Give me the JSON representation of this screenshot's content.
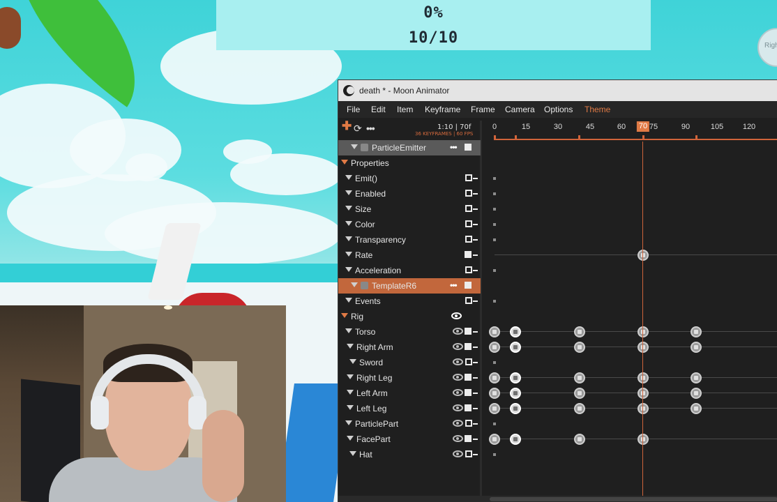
{
  "hud": {
    "percent": "0%",
    "count": "10/10"
  },
  "corner_avatar": {
    "label": "Righ"
  },
  "window": {
    "title": "death * - Moon Animator"
  },
  "menu": [
    "File",
    "Edit",
    "Item",
    "Keyframe",
    "Frame",
    "Camera",
    "Options",
    "Theme"
  ],
  "toolbar": {
    "add_icon": "plus-icon",
    "loop_icon": "loop-icon",
    "more_icon": "more-icon",
    "time": "1:10 | 70f",
    "stats": "36 KEYFRAMES | 60 FPS"
  },
  "ruler": {
    "ticks": [
      "0",
      "15",
      "30",
      "45",
      "60",
      "75",
      "90",
      "105",
      "120"
    ],
    "current_frame": "70",
    "accent": "#d0643a"
  },
  "tree": [
    {
      "label": "ParticleEmitter",
      "kind": "object",
      "selected": "grey"
    },
    {
      "label": "Properties",
      "kind": "group"
    },
    {
      "label": "Emit()",
      "kind": "prop"
    },
    {
      "label": "Enabled",
      "kind": "prop"
    },
    {
      "label": "Size",
      "kind": "prop"
    },
    {
      "label": "Color",
      "kind": "prop"
    },
    {
      "label": "Transparency",
      "kind": "prop"
    },
    {
      "label": "Rate",
      "kind": "prop"
    },
    {
      "label": "Acceleration",
      "kind": "prop"
    },
    {
      "label": "TemplateR6",
      "kind": "object",
      "selected": "orange"
    },
    {
      "label": "Events",
      "kind": "prop"
    },
    {
      "label": "Rig",
      "kind": "rig"
    },
    {
      "label": "Torso",
      "kind": "part"
    },
    {
      "label": "Right Arm",
      "kind": "part"
    },
    {
      "label": "Sword",
      "kind": "part"
    },
    {
      "label": "Right Leg",
      "kind": "part"
    },
    {
      "label": "Left Arm",
      "kind": "part"
    },
    {
      "label": "Left Leg",
      "kind": "part"
    },
    {
      "label": "ParticlePart",
      "kind": "part"
    },
    {
      "label": "FacePart",
      "kind": "part"
    },
    {
      "label": "Hat",
      "kind": "part"
    }
  ],
  "keyframes": {
    "Rate": [
      70
    ],
    "Torso": [
      0,
      10,
      40,
      70,
      95
    ],
    "Right Arm": [
      0,
      10,
      40,
      70,
      95
    ],
    "Right Leg": [
      0,
      10,
      40,
      70,
      95
    ],
    "Left Arm": [
      0,
      10,
      40,
      70,
      95
    ],
    "Left Leg": [
      0,
      10,
      40,
      70,
      95
    ],
    "FacePart": [
      0,
      10,
      40,
      70
    ]
  }
}
